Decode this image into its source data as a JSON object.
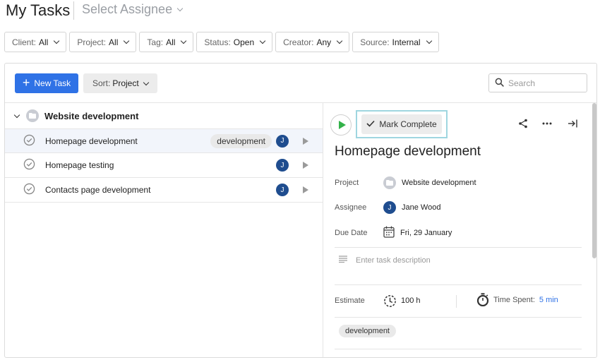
{
  "header": {
    "title": "My Tasks",
    "assignee_placeholder": "Select Assignee"
  },
  "filters": [
    {
      "label": "Client:",
      "value": "All"
    },
    {
      "label": "Project:",
      "value": "All"
    },
    {
      "label": "Tag:",
      "value": "All"
    },
    {
      "label": "Status:",
      "value": "Open"
    },
    {
      "label": "Creator:",
      "value": "Any"
    },
    {
      "label": "Source:",
      "value": "Internal"
    }
  ],
  "toolbar": {
    "new_task_label": "New Task",
    "sort_label": "Sort:",
    "sort_value": "Project",
    "search_placeholder": "Search"
  },
  "task_list": {
    "group_name": "Website development",
    "tasks": [
      {
        "name": "Homepage development",
        "tag": "development",
        "assignee_initial": "J"
      },
      {
        "name": "Homepage testing",
        "assignee_initial": "J"
      },
      {
        "name": "Contacts page development",
        "assignee_initial": "J"
      }
    ]
  },
  "detail": {
    "mark_complete_label": "Mark Complete",
    "title": "Homepage development",
    "project_label": "Project",
    "project_value": "Website development",
    "assignee_label": "Assignee",
    "assignee_initial": "J",
    "assignee_value": "Jane Wood",
    "due_label": "Due Date",
    "due_value": "Fri, 29 January",
    "description_placeholder": "Enter task description",
    "estimate_label": "Estimate",
    "estimate_value": "100 h",
    "time_spent_label": "Time Spent:",
    "time_spent_value": "5 min",
    "tag": "development"
  },
  "colors": {
    "accent": "#2f72e6",
    "avatar": "#1f4d8f",
    "play": "#33b24a",
    "highlight_frame": "#9fd6e0"
  }
}
